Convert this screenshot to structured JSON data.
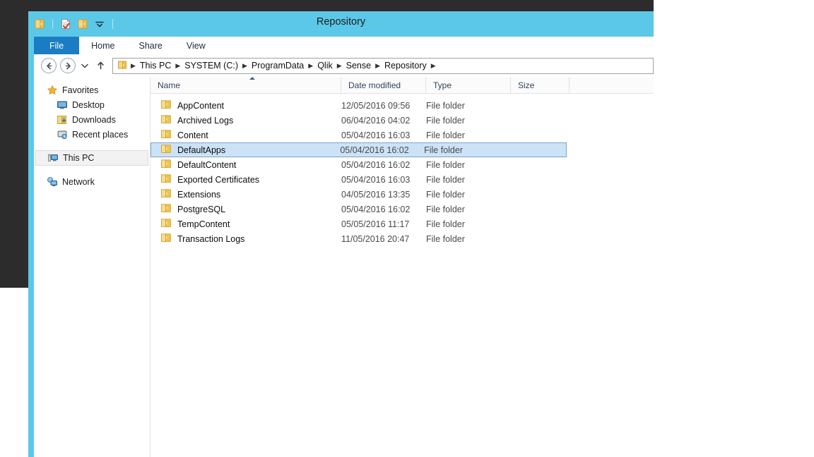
{
  "window": {
    "title": "Repository",
    "titlebar_color": "#5bc8e8",
    "accent_color": "#1a7dc4"
  },
  "quick_access_toolbar": {
    "items": [
      {
        "name": "folder-icon",
        "label": "Folder"
      },
      {
        "name": "properties-icon",
        "label": "Properties"
      },
      {
        "name": "new-folder-icon",
        "label": "New folder"
      },
      {
        "name": "chevron-down-icon",
        "label": "Customize Quick Access Toolbar"
      }
    ]
  },
  "ribbon": {
    "tabs": [
      {
        "label": "File",
        "selected": true
      },
      {
        "label": "Home",
        "selected": false
      },
      {
        "label": "Share",
        "selected": false
      },
      {
        "label": "View",
        "selected": false
      }
    ]
  },
  "navigation": {
    "back_label": "Back",
    "forward_label": "Forward",
    "recent_label": "Recent locations",
    "up_label": "Up one level",
    "breadcrumb": [
      "This PC",
      "SYSTEM (C:)",
      "ProgramData",
      "Qlik",
      "Sense",
      "Repository"
    ]
  },
  "sidebar": {
    "items": [
      {
        "label": "Favorites",
        "icon": "star-icon",
        "level": 0,
        "selected": false
      },
      {
        "label": "Desktop",
        "icon": "desktop-icon",
        "level": 1,
        "selected": false
      },
      {
        "label": "Downloads",
        "icon": "downloads-icon",
        "level": 1,
        "selected": false
      },
      {
        "label": "Recent places",
        "icon": "recent-places-icon",
        "level": 1,
        "selected": false
      },
      {
        "label": "This PC",
        "icon": "this-pc-icon",
        "level": 0,
        "selected": true
      },
      {
        "label": "Network",
        "icon": "network-icon",
        "level": 0,
        "selected": false
      }
    ]
  },
  "file_list": {
    "columns": [
      {
        "label": "Name",
        "sort": "asc"
      },
      {
        "label": "Date modified",
        "sort": null
      },
      {
        "label": "Type",
        "sort": null
      },
      {
        "label": "Size",
        "sort": null
      }
    ],
    "rows": [
      {
        "name": "AppContent",
        "date": "12/05/2016 09:56",
        "type": "File folder",
        "size": "",
        "selected": false
      },
      {
        "name": "Archived Logs",
        "date": "06/04/2016 04:02",
        "type": "File folder",
        "size": "",
        "selected": false
      },
      {
        "name": "Content",
        "date": "05/04/2016 16:03",
        "type": "File folder",
        "size": "",
        "selected": false
      },
      {
        "name": "DefaultApps",
        "date": "05/04/2016 16:02",
        "type": "File folder",
        "size": "",
        "selected": true
      },
      {
        "name": "DefaultContent",
        "date": "05/04/2016 16:02",
        "type": "File folder",
        "size": "",
        "selected": false
      },
      {
        "name": "Exported Certificates",
        "date": "05/04/2016 16:03",
        "type": "File folder",
        "size": "",
        "selected": false
      },
      {
        "name": "Extensions",
        "date": "04/05/2016 13:35",
        "type": "File folder",
        "size": "",
        "selected": false
      },
      {
        "name": "PostgreSQL",
        "date": "05/04/2016 16:02",
        "type": "File folder",
        "size": "",
        "selected": false
      },
      {
        "name": "TempContent",
        "date": "05/05/2016 11:17",
        "type": "File folder",
        "size": "",
        "selected": false
      },
      {
        "name": "Transaction Logs",
        "date": "11/05/2016 20:47",
        "type": "File folder",
        "size": "",
        "selected": false
      }
    ]
  }
}
